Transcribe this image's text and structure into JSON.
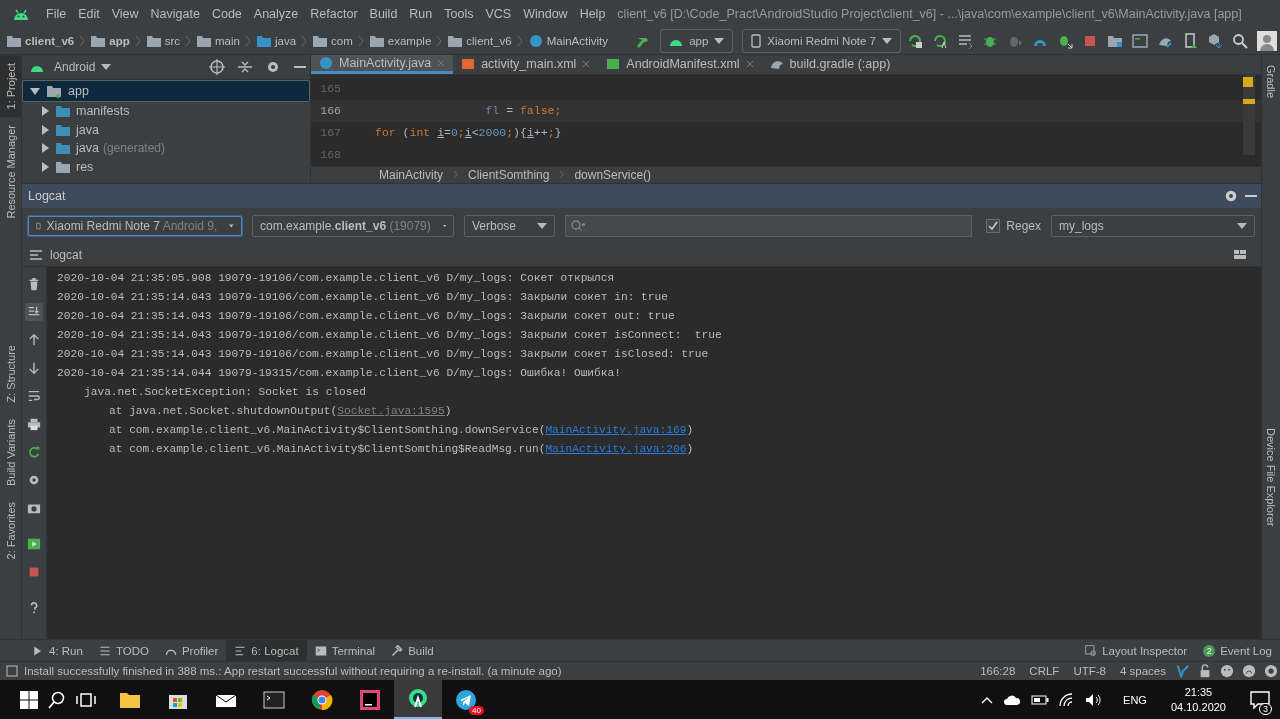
{
  "menu": {
    "items": [
      "File",
      "Edit",
      "View",
      "Navigate",
      "Code",
      "Analyze",
      "Refactor",
      "Build",
      "Run",
      "Tools",
      "VCS",
      "Window",
      "Help"
    ],
    "title": "client_v6 [D:\\Code_Pract\\AndroidStudio Project\\client_v6] - ...\\java\\com\\example\\client_v6\\MainActivity.java [app]"
  },
  "breadcrumbs": [
    {
      "label": "client_v6",
      "bold": true
    },
    {
      "label": "app",
      "bold": true
    },
    {
      "label": "src",
      "bold": false
    },
    {
      "label": "main",
      "bold": false
    },
    {
      "label": "java",
      "bold": false
    },
    {
      "label": "com",
      "bold": false
    },
    {
      "label": "example",
      "bold": false
    },
    {
      "label": "client_v6",
      "bold": false
    },
    {
      "label": "MainActivity",
      "bold": false
    }
  ],
  "run_config": "app",
  "device": "Xiaomi Redmi Note 7",
  "left_stripe": [
    {
      "label": "1: Project",
      "selected": true
    },
    {
      "label": "Resource Manager",
      "selected": false
    },
    {
      "label": "Z: Structure",
      "selected": false
    },
    {
      "label": "Build Variants",
      "selected": false
    },
    {
      "label": "2: Favorites",
      "selected": false
    }
  ],
  "right_stripe": [
    "Gradle",
    "Device File Explorer"
  ],
  "project_panel": {
    "view": "Android",
    "tree": [
      {
        "label": "app",
        "selected": true,
        "expanded": true,
        "children": [
          {
            "label": "manifests",
            "selected": false,
            "expanded": false
          },
          {
            "label": "java",
            "selected": false,
            "expanded": false
          },
          {
            "label": "java",
            "note": "(generated)",
            "selected": false,
            "expanded": false
          },
          {
            "label": "res",
            "selected": false,
            "expanded": false
          }
        ]
      }
    ]
  },
  "editor": {
    "tabs": [
      {
        "label": "MainActivity.java",
        "selected": true
      },
      {
        "label": "activity_main.xml",
        "selected": false
      },
      {
        "label": "AndroidManifest.xml",
        "selected": false
      },
      {
        "label": "build.gradle (:app)",
        "selected": false
      }
    ],
    "lines": [
      {
        "number": "165",
        "current": false
      },
      {
        "number": "166",
        "current": true,
        "code": [
          {
            "text": "                fl",
            "kind": "field"
          },
          {
            "text": " = ",
            "kind": "plain"
          },
          {
            "text": "false",
            "kind": "keyword"
          },
          {
            "text": ";",
            "kind": "keyword"
          }
        ]
      },
      {
        "number": "167",
        "current": false,
        "code": [
          {
            "text": "for",
            "kind": "keyword"
          },
          {
            "text": " (",
            "kind": "plain"
          },
          {
            "text": "int ",
            "kind": "keyword"
          },
          {
            "text": "i",
            "kind": "reassigned"
          },
          {
            "text": "=",
            "kind": "plain"
          },
          {
            "text": "0",
            "kind": "number"
          },
          {
            "text": ";",
            "kind": "keyword"
          },
          {
            "text": "i",
            "kind": "reassigned"
          },
          {
            "text": "<",
            "kind": "plain"
          },
          {
            "text": "2000",
            "kind": "number"
          },
          {
            "text": ";",
            "kind": "keyword"
          },
          {
            "text": "){",
            "kind": "plain"
          },
          {
            "text": "i",
            "kind": "reassigned"
          },
          {
            "text": "++",
            "kind": "plain"
          },
          {
            "text": ";",
            "kind": "keyword"
          },
          {
            "text": "}",
            "kind": "plain"
          }
        ]
      },
      {
        "number": "168",
        "current": false
      }
    ],
    "crumbs": [
      "MainActivity",
      "ClientSomthing",
      "downService()"
    ]
  },
  "logcat": {
    "title": "Logcat",
    "device": "Xiaomi Redmi Note 7",
    "device_note": "Android 9,",
    "process": "com.example.**client_v6**",
    "pid": "(19079)",
    "level": "Verbose",
    "regex": {
      "label": "Regex",
      "checked": true
    },
    "filter": "my_logs",
    "tab": "logcat",
    "rows": [
      {
        "kind": "entry",
        "text": "2020-10-04 21:35:05.908 19079-19106/com.example.client_v6 D/my_logs: Сокет открылся"
      },
      {
        "kind": "entry",
        "text": "2020-10-04 21:35:14.043 19079-19106/com.example.client_v6 D/my_logs: Закрыли сокет in: true"
      },
      {
        "kind": "entry",
        "text": "2020-10-04 21:35:14.043 19079-19106/com.example.client_v6 D/my_logs: Закрыли сокет out: true"
      },
      {
        "kind": "entry",
        "text": "2020-10-04 21:35:14.043 19079-19106/com.example.client_v6 D/my_logs: Закрыли сокет isConnect:  true"
      },
      {
        "kind": "entry",
        "text": "2020-10-04 21:35:14.043 19079-19106/com.example.client_v6 D/my_logs: Закрыли сокет isClosed: true"
      },
      {
        "kind": "entry",
        "text": "2020-10-04 21:35:14.044 19079-19315/com.example.client_v6 D/my_logs: Ошибка! Ошибка!"
      },
      {
        "kind": "exception",
        "text": "java.net.SocketException: Socket is closed"
      },
      {
        "kind": "stack",
        "text": "at java.net.Socket.shutdownOutput(",
        "link": "Socket.java:1595",
        "library": true,
        "end": ")"
      },
      {
        "kind": "stack",
        "text": "at com.example.client_v6.MainActivity$ClientSomthing.downService(",
        "link": "MainActivity.java:169",
        "library": false,
        "end": ")"
      },
      {
        "kind": "stack",
        "text": "at com.example.client_v6.MainActivity$ClientSomthing$ReadMsg.run(",
        "link": "MainActivity.java:206",
        "library": false,
        "end": ")"
      }
    ]
  },
  "tool_tabs": [
    {
      "label": "4: Run",
      "selected": false
    },
    {
      "label": "TODO",
      "selected": false
    },
    {
      "label": "Profiler",
      "selected": false
    },
    {
      "label": "6: Logcat",
      "selected": true
    },
    {
      "label": "Terminal",
      "selected": false
    },
    {
      "label": "Build",
      "selected": false
    }
  ],
  "tool_tabs_right": [
    {
      "label": "Layout Inspector"
    },
    {
      "label": "Event Log",
      "badge": "2"
    }
  ],
  "status": {
    "message": "Install successfully finished in 388 ms.: App restart successful without requiring a re-install. (a minute ago)",
    "items": [
      "166:28",
      "CRLF",
      "UTF-8",
      "4 spaces"
    ]
  },
  "taskbar": {
    "language": "ENG",
    "time": "21:35",
    "date": "04.10.2020",
    "telegram_badge": "40",
    "notifications": "3"
  }
}
